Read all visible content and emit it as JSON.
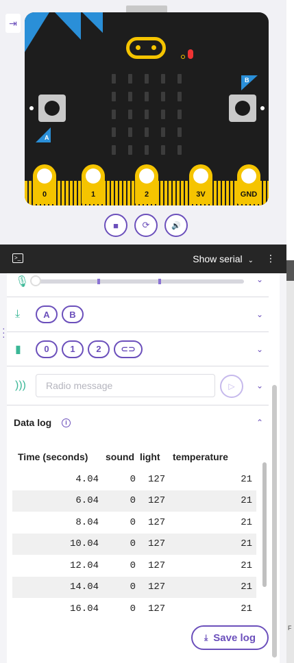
{
  "simulator": {
    "pins": [
      "0",
      "1",
      "2",
      "3V",
      "GND"
    ],
    "button_a": "A",
    "button_b": "B",
    "controls": {
      "stop": "■",
      "reset": "⟳",
      "sound": "🔊"
    }
  },
  "serial": {
    "show_label": "Show serial",
    "chevron": "⌄",
    "menu": "⋮"
  },
  "sensors": {
    "buttons": [
      "A",
      "B"
    ],
    "touch": [
      "0",
      "1",
      "2",
      "⊂⊃"
    ],
    "radio_placeholder": "Radio message"
  },
  "datalog": {
    "title": "Data log",
    "info": "i",
    "columns": [
      "Time (seconds)",
      "sound",
      "light",
      "temperature"
    ],
    "rows": [
      [
        "4.04",
        "0",
        "127",
        "21"
      ],
      [
        "6.04",
        "0",
        "127",
        "21"
      ],
      [
        "8.04",
        "0",
        "127",
        "21"
      ],
      [
        "10.04",
        "0",
        "127",
        "21"
      ],
      [
        "12.04",
        "0",
        "127",
        "21"
      ],
      [
        "14.04",
        "0",
        "127",
        "21"
      ],
      [
        "16.04",
        "0",
        "127",
        "21"
      ]
    ],
    "save_label": "Save log"
  },
  "colors": {
    "accent": "#6b4fbb",
    "sensor_green": "#3ab796",
    "board": "#1d1d1d",
    "gold": "#f5c400"
  },
  "strip_letter": "F"
}
